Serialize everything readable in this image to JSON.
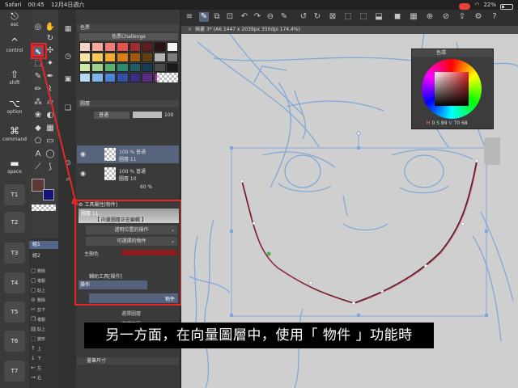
{
  "status_bar": {
    "app": "Safari",
    "time": "00:45",
    "date": "12月4日週六",
    "battery": "22%"
  },
  "edge_keyboard": {
    "keys": [
      "esc",
      "control",
      "shift",
      "option",
      "command",
      "space"
    ],
    "t_keys": [
      "T1",
      "T2",
      "T3",
      "T4",
      "T5",
      "T6",
      "T7"
    ]
  },
  "colorset_panel": {
    "title": "色票",
    "set_name": "色票Challenge",
    "swatches": [
      "#f7d2c6",
      "#f4a99c",
      "#f07c78",
      "#e6534d",
      "#a02d2d",
      "#5d1f1f",
      "#2d1414",
      "#f3f3f3",
      "#f9e6a6",
      "#f7c85b",
      "#f2a935",
      "#d97f17",
      "#9c5a10",
      "#614015",
      "#b5b5b5",
      "#7d7d7d",
      "#cfe8a8",
      "#9fd18a",
      "#58b26d",
      "#2c8a6f",
      "#1d5b68",
      "#173b52",
      "#4a4a4a",
      "#1a1a1a",
      "#b8d9f2",
      "#7fb6ec",
      "#4a84d6",
      "#3150a8",
      "#3a2d84",
      "#5b2b86",
      "#8c3b94",
      "#c95ea9"
    ]
  },
  "layer_panel": {
    "title": "圖層",
    "blend_mode": "普通",
    "opacity": "100",
    "layers": [
      {
        "percent": "100 %",
        "mode": "普通",
        "name": "圖層 11"
      },
      {
        "percent": "100 %",
        "mode": "普通",
        "name": "圖層 10"
      },
      {
        "percent": "60 %",
        "mode": "",
        "name": ""
      }
    ]
  },
  "tool_property": {
    "title": "工具屬性[物件]",
    "banner_label": "圖層 11",
    "banner_sub": "【 向量圖層正在編輯 】",
    "selects": [
      "透明位置的操作",
      "可選擇的物件"
    ],
    "label_main": "主顏色"
  },
  "aux_panel": {
    "title": "輔助工具[操作]",
    "tab": "操作",
    "item": "物件"
  },
  "below_labels": [
    "選擇圖層",
    "選擇範圍"
  ],
  "subtool": {
    "tab": "組1",
    "items": [
      "組1",
      "組2"
    ],
    "commands": [
      "刪除",
      "複製",
      "貼上",
      "刪除",
      "剪下",
      "複製",
      "貼上",
      "變形",
      "上",
      "下",
      "左",
      "右"
    ]
  },
  "nav_panel": {
    "title": "畫筆尺寸"
  },
  "canvas_tab": {
    "label": "插畫 3* (A6 1447 x 2039px 350dpi 174.4%)"
  },
  "color_window": {
    "title": "色環",
    "h": "0",
    "s": "89",
    "v": "70",
    "extra": "68"
  },
  "caption": "另一方面，在向量圖層中，使用「 物件 」功能時",
  "colors": {
    "highlight": "#e8262a",
    "sketch": "#7aa4d8",
    "curve": "#5a1622",
    "selection": "#7ea6dc"
  }
}
